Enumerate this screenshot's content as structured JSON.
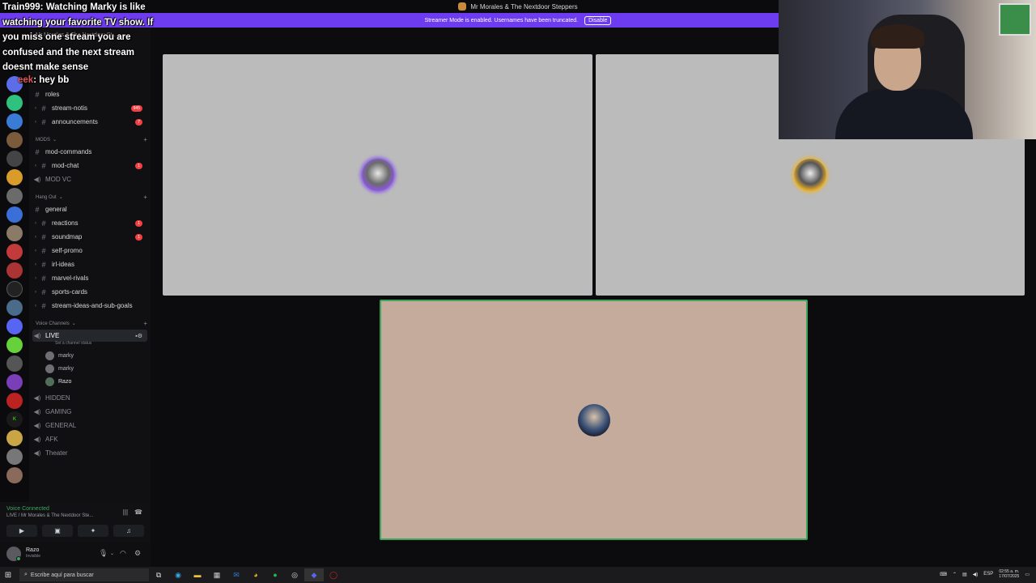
{
  "titlebar": {
    "server": "Mr Morales & The Nextdoor Steppers"
  },
  "banner": {
    "text": "Streamer Mode is enabled. Usernames have been truncated.",
    "button": "Disable"
  },
  "chat": {
    "msg1_user": "Train999",
    "msg1_text": ": Watching Marky is like watching your favorite TV show. If you miss one stream you are confused and the next stream doesnt make sense",
    "msg2_user": "eek",
    "msg2_text": ": hey bb"
  },
  "sidebar": {
    "server_name": "Mr Morales & The Nextdoor St...",
    "channels_top": [
      {
        "label": "roles",
        "badge": ""
      },
      {
        "label": "stream-notis",
        "badge": "945"
      },
      {
        "label": "announcements",
        "badge": "7"
      }
    ],
    "category_mods": "MODS",
    "channels_mods": [
      {
        "label": "mod-commands",
        "badge": ""
      },
      {
        "label": "mod-chat",
        "badge": "1"
      },
      {
        "label": "MOD VC",
        "badge": ""
      }
    ],
    "category_hangout": "Hang Out",
    "channels_hangout": [
      {
        "label": "general",
        "badge": ""
      },
      {
        "label": "reactions",
        "badge": "1"
      },
      {
        "label": "soundmap",
        "badge": "1"
      },
      {
        "label": "self-promo",
        "badge": ""
      },
      {
        "label": "irl-ideas",
        "badge": ""
      },
      {
        "label": "marvel-rivals",
        "badge": ""
      },
      {
        "label": "sports-cards",
        "badge": ""
      },
      {
        "label": "stream-ideas-and-sub-goals",
        "badge": ""
      }
    ],
    "category_voice": "Voice Channels",
    "voice_live": "LIVE",
    "voice_status_placeholder": "Set a channel status",
    "voice_users": [
      "marky",
      "marky",
      "Razo"
    ],
    "voice_channels": [
      "HIDDEN",
      "GAMING",
      "GENERAL",
      "AFK",
      "Theater"
    ]
  },
  "voice_panel": {
    "title": "Voice Connected",
    "subtitle": "LIVE / Mr Morales & The Nextdoor Ste..."
  },
  "user": {
    "name": "Razo",
    "status": "Invisible"
  },
  "taskbar": {
    "search_placeholder": "Escribe aquí para buscar",
    "lang": "ESP",
    "time": "02:55 a. m.",
    "date": "17/07/2025"
  },
  "colors": {
    "accent": "#6e3cf0",
    "online": "#3ba55c",
    "badge": "#f23f43"
  }
}
